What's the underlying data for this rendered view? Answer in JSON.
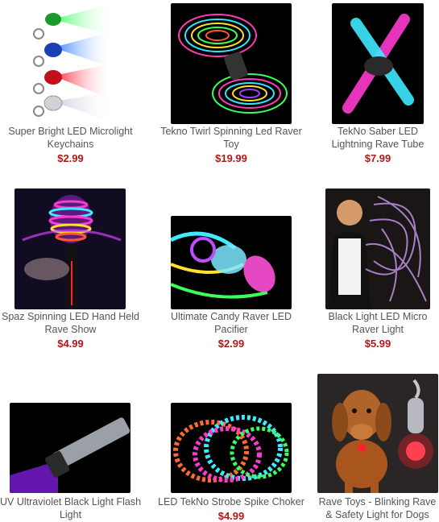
{
  "products": [
    {
      "title_line1": "Super Bright LED Microlight",
      "title_line2": "Keychains",
      "price": "$2.99",
      "image": "keychain-image"
    },
    {
      "title_line1": "Tekno Twirl Spinning Led Raver",
      "title_line2": "Toy",
      "price": "$19.99",
      "image": "twirl-toy-image"
    },
    {
      "title_line1": "TekNo Saber LED",
      "title_line2": "Lightning Rave Tube",
      "price": "$7.99",
      "image": "saber-image"
    },
    {
      "title_line1": "Spaz Spinning LED Hand Held",
      "title_line2": "Rave Show",
      "price": "$4.99",
      "image": "spaz-image"
    },
    {
      "title_line1": "Ultimate Candy Raver LED",
      "title_line2": "Pacifier",
      "price": "$2.99",
      "image": "pacifier-image"
    },
    {
      "title_line1": "Black Light LED Micro",
      "title_line2": "Raver Light",
      "price": "$5.99",
      "image": "micro-light-image"
    },
    {
      "title_line1": "UV Ultraviolet Black Light Flash",
      "title_line2": "Light",
      "price": "",
      "image": "flashlight-image"
    },
    {
      "title_line1": "LED TekNo Strobe Spike Choker",
      "title_line2": "",
      "price": "$4.99",
      "image": "choker-image"
    },
    {
      "title_line1": "Rave Toys - Blinking Rave",
      "title_line2": "& Safety Light for Dogs",
      "price": "",
      "image": "dog-light-image"
    }
  ]
}
